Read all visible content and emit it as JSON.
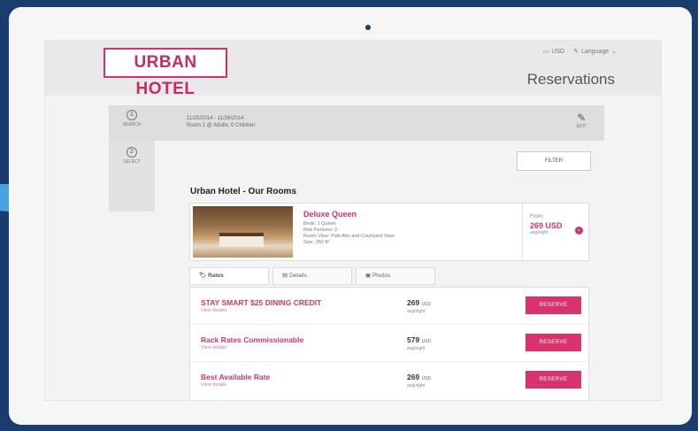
{
  "header": {
    "logo": "URBAN HOTEL",
    "currency": "USD",
    "language": "Language",
    "title": "Reservations"
  },
  "search": {
    "search_label": "SEARCH",
    "select_label": "SELECT",
    "dates": "11/25/2014 - 11/26/2014",
    "guests": "Room 1 @ Adults, 0 Children",
    "edit_label": "EDIT"
  },
  "filter_label": "FILTER",
  "section_title": "Urban Hotel - Our Rooms",
  "room": {
    "name": "Deluxe Queen",
    "details": [
      "Beds: 1 Queen",
      "Max Persons: 2",
      "Room View: Palo Alto and Courtyard View",
      "Size: 350 ft²"
    ],
    "from_label": "From",
    "price": "269 USD",
    "per_night": "avg/night"
  },
  "tabs": [
    "Rates",
    "Details",
    "Photos"
  ],
  "rates": [
    {
      "name": "STAY SMART $25 DINING CREDIT",
      "sub": "View details",
      "price": "269",
      "currency": "USD",
      "per": "avg/night",
      "action": "RESERVE"
    },
    {
      "name": "Rack Rates Commissionable",
      "sub": "View details",
      "price": "579",
      "currency": "USD",
      "per": "avg/night",
      "action": "RESERVE"
    },
    {
      "name": "Best Available Rate",
      "sub": "View details",
      "price": "269",
      "currency": "USD",
      "per": "avg/night",
      "action": "RESERVE"
    }
  ]
}
